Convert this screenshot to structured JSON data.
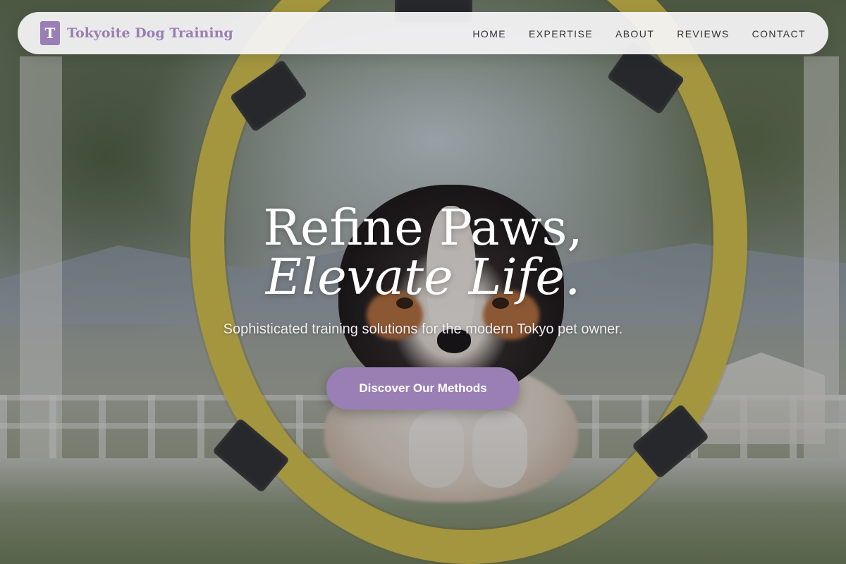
{
  "brand": {
    "logo_letter": "T",
    "name": "Tokyoite Dog Training"
  },
  "nav": {
    "items": [
      {
        "label": "HOME"
      },
      {
        "label": "EXPERTISE"
      },
      {
        "label": "ABOUT"
      },
      {
        "label": "REVIEWS"
      },
      {
        "label": "CONTACT"
      }
    ]
  },
  "hero": {
    "headline_line1": "Refine Paws,",
    "headline_line2": "Elevate Life.",
    "subtitle": "Sophisticated training solutions for the modern Tokyo pet owner.",
    "cta_label": "Discover Our Methods"
  },
  "colors": {
    "accent": "#9a7fb5",
    "nav_text": "#333333",
    "nav_background": "#f6f5f8",
    "hoop_yellow": "#d7c54a",
    "hoop_tape": "#2b2d2e"
  }
}
